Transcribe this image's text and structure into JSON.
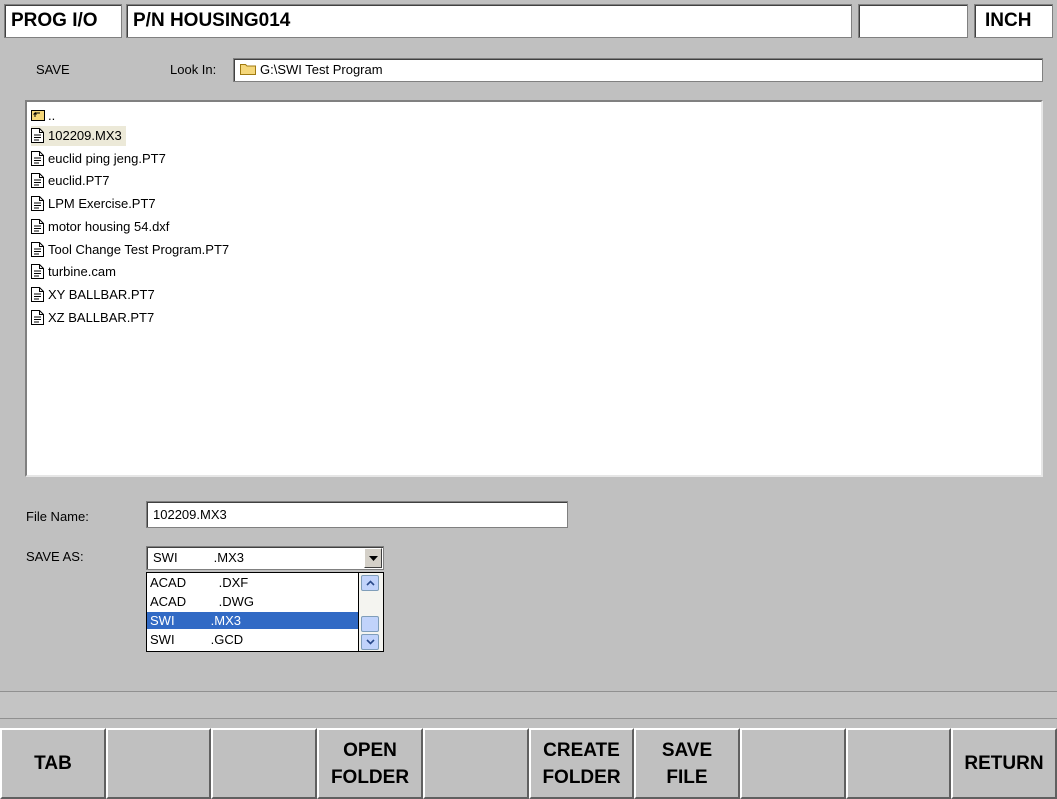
{
  "header": {
    "mode": "PROG I/O",
    "part_number": "P/N  HOUSING014",
    "status": "",
    "units": "INCH"
  },
  "dialog": {
    "action": "SAVE",
    "look_in_label": "Look In:",
    "look_in_path": "G:\\SWI Test Program",
    "parent_folder": "..",
    "files": [
      {
        "name": "102209.MX3",
        "icon": "document-icon"
      },
      {
        "name": "euclid ping jeng.PT7",
        "icon": "document-icon"
      },
      {
        "name": "euclid.PT7",
        "icon": "document-icon"
      },
      {
        "name": "LPM Exercise.PT7",
        "icon": "document-icon"
      },
      {
        "name": "motor housing 54.dxf",
        "icon": "document-icon"
      },
      {
        "name": "Tool Change Test Program.PT7",
        "icon": "document-icon"
      },
      {
        "name": "turbine.cam",
        "icon": "document-icon"
      },
      {
        "name": "XY BALLBAR.PT7",
        "icon": "document-icon"
      },
      {
        "name": "XZ BALLBAR.PT7",
        "icon": "document-icon"
      }
    ],
    "selected_file_index": 0,
    "file_name_label": "File Name:",
    "file_name_value": "102209.MX3",
    "save_as_label": "SAVE AS:",
    "save_as_value": "SWI          .MX3",
    "save_as_options": [
      "ACAD         .DXF",
      "ACAD         .DWG",
      "SWI          .MX3",
      "SWI          .GCD"
    ],
    "save_as_selected_index": 2
  },
  "message": "",
  "softkeys": [
    "TAB",
    "",
    "",
    "OPEN\nFOLDER",
    "",
    "CREATE\nFOLDER",
    "SAVE\nFILE",
    "",
    "",
    "RETURN"
  ],
  "colors": {
    "background": "#c0c0c0",
    "selection_highlight": "#316ac5",
    "file_selection": "#ece9d8"
  }
}
